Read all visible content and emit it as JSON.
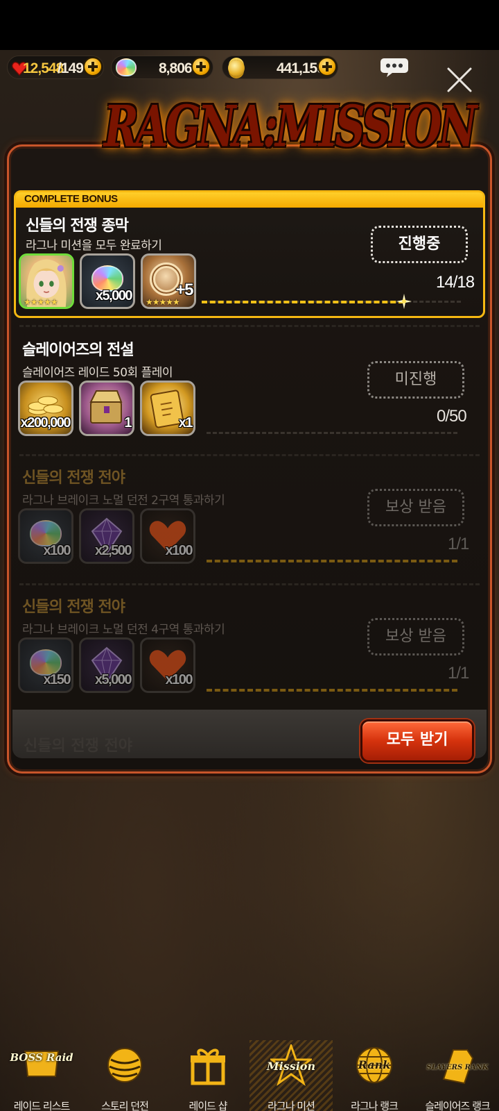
{
  "currency": {
    "stamina_current": "12,548",
    "stamina_max": "/149",
    "gems": "8,806",
    "gold": "441,159"
  },
  "header": {
    "title": "RAGNA:MISSION"
  },
  "complete_bonus": {
    "label": "COMPLETE BONUS",
    "title": "신들의 전쟁 종막",
    "desc": "라그나 미션을 모두 완료하기",
    "state": "진행중",
    "progress_text": "14/18",
    "progress": 0.78,
    "rewards": [
      {
        "icon": "character-portrait-icon",
        "qty": "",
        "stars": "★★★★★"
      },
      {
        "icon": "rainbow-gem-icon",
        "qty": "x5,000"
      },
      {
        "icon": "gold-ring-icon",
        "qty": "+5",
        "stars": "★★★★★"
      }
    ]
  },
  "missions": [
    {
      "title": "슬레이어즈의 전설",
      "desc": "슬레이어즈 레이드 50회 플레이",
      "state": "미진행",
      "progress_text": "0/50",
      "progress": 0,
      "rewards": [
        {
          "icon": "gold-coins-icon",
          "qty": "x200,000"
        },
        {
          "icon": "treasure-box-icon",
          "qty": "1"
        },
        {
          "icon": "gold-ticket-icon",
          "qty": "x1"
        }
      ]
    },
    {
      "title": "신들의 전쟁 전야",
      "desc": "라그나 브레이크 노멀 던전 2구역 통과하기",
      "state": "보상 받음",
      "progress_text": "1/1",
      "progress": 1,
      "rewards": [
        {
          "icon": "rainbow-gem-icon",
          "qty": "x100"
        },
        {
          "icon": "purple-gem-icon",
          "qty": "x2,500"
        },
        {
          "icon": "heart-icon",
          "qty": "x100"
        }
      ]
    },
    {
      "title": "신들의 전쟁 전야",
      "desc": "라그나 브레이크 노멀 던전 4구역 통과하기",
      "state": "보상 받음",
      "progress_text": "1/1",
      "progress": 1,
      "rewards": [
        {
          "icon": "rainbow-gem-icon",
          "qty": "x150"
        },
        {
          "icon": "purple-gem-icon",
          "qty": "x5,000"
        },
        {
          "icon": "heart-icon",
          "qty": "x100"
        }
      ]
    }
  ],
  "ghost_title": "신들의 전쟁 전야",
  "claim_all_label": "모두 받기",
  "nav": [
    {
      "label": "레이드 리스트",
      "logo": "BOSS Raid",
      "active": false
    },
    {
      "label": "스토리 던전",
      "logo": "",
      "active": false
    },
    {
      "label": "레이드 샵",
      "logo": "",
      "active": false
    },
    {
      "label": "라그나 미션",
      "logo": "Mission",
      "active": true
    },
    {
      "label": "라그나 랭크",
      "logo": "Rank",
      "active": false
    },
    {
      "label": "슬레이어즈 랭크",
      "logo": "SLAYERS RANK",
      "active": false
    }
  ],
  "colors": {
    "gold": "#f6b812",
    "accent_red": "#d5320d",
    "frame": "#c8552a"
  }
}
